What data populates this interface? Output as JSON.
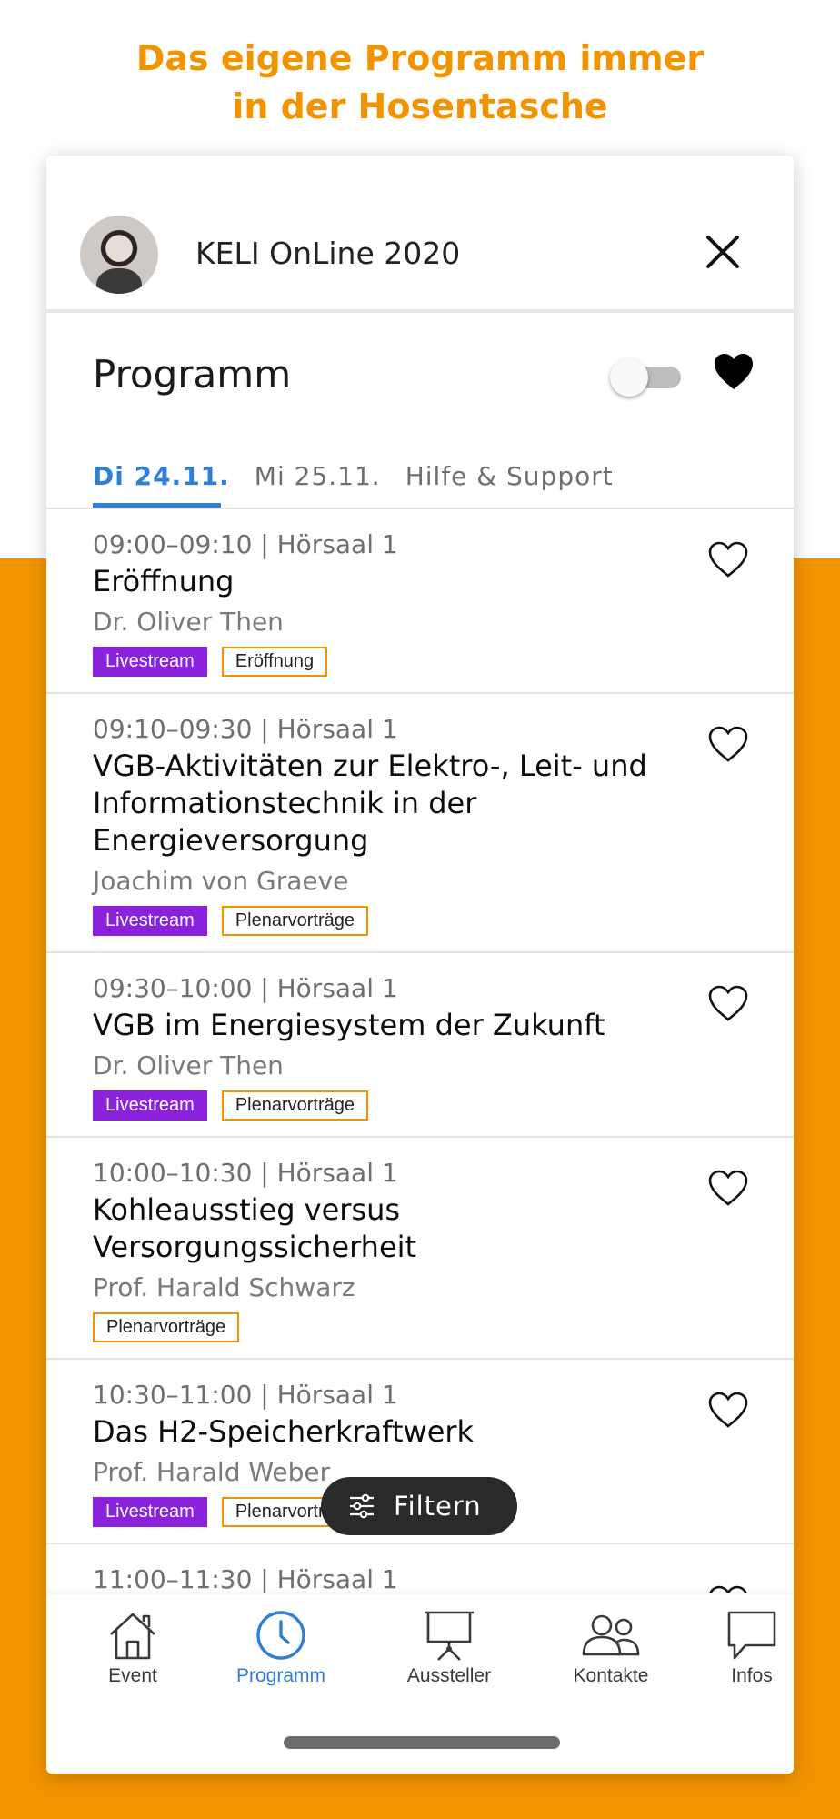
{
  "headline": {
    "line1": "Das eigene Programm immer",
    "line2": "in der Hosentasche"
  },
  "colors": {
    "accent": "#F29400",
    "livestream": "#8A22DC",
    "active_blue": "#2f7fd8"
  },
  "header": {
    "event_title": "KELI OnLine 2020",
    "avatar": "speaker-avatar",
    "close_icon": "close-icon"
  },
  "program": {
    "title": "Programm",
    "favorites_only_toggle": "off",
    "tabs": [
      {
        "label": "Di 24.11.",
        "active": true
      },
      {
        "label": "Mi 25.11.",
        "active": false
      },
      {
        "label": "Hilfe & Support",
        "active": false
      }
    ]
  },
  "sessions": [
    {
      "time": "09:00–09:10 | Hörsaal 1",
      "title": "Eröffnung",
      "speaker": "Dr. Oliver Then",
      "livestream": "Livestream",
      "category": "Eröffnung"
    },
    {
      "time": "09:10–09:30 | Hörsaal 1",
      "title": "VGB-Aktivitäten zur Elektro-, Leit- und Informationstechnik in der Energieversorgung",
      "speaker": "Joachim von Graeve",
      "livestream": "Livestream",
      "category": "Plenarvorträge"
    },
    {
      "time": "09:30–10:00 | Hörsaal 1",
      "title": "VGB im Energiesystem der Zukunft",
      "speaker": "Dr. Oliver Then",
      "livestream": "Livestream",
      "category": "Plenarvorträge"
    },
    {
      "time": "10:00–10:30 | Hörsaal 1",
      "title": "Kohleausstieg versus Versorgungssicherheit",
      "speaker": "Prof. Harald Schwarz",
      "livestream": "",
      "category": "Plenarvorträge"
    },
    {
      "time": "10:30–11:00 | Hörsaal 1",
      "title": "Das H2-Speicherkraftwerk",
      "speaker": "Prof. Harald Weber",
      "livestream": "Livestream",
      "category": "Plenarvorträge"
    },
    {
      "time": "11:00–11:30 | Hörsaal 1",
      "title": "",
      "speaker": "",
      "livestream": "",
      "category": ""
    }
  ],
  "filter_button": {
    "label": "Filtern"
  },
  "bottom_nav": [
    {
      "label": "Event",
      "icon": "house-icon",
      "active": false
    },
    {
      "label": "Programm",
      "icon": "clock-icon",
      "active": true
    },
    {
      "label": "Aussteller",
      "icon": "presentation-board-icon",
      "active": false
    },
    {
      "label": "Kontakte",
      "icon": "people-icon",
      "active": false
    },
    {
      "label": "Infos",
      "icon": "chat-bubble-icon",
      "active": false
    }
  ]
}
